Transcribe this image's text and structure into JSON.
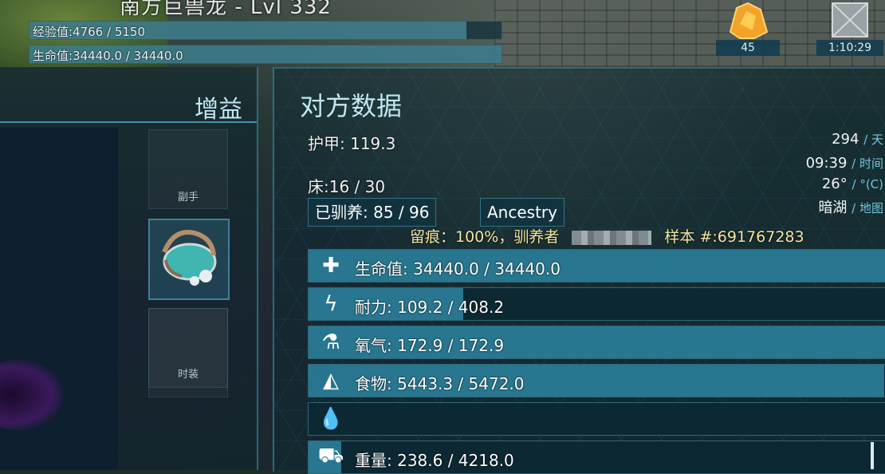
{
  "creature": {
    "name": "南方巨兽龙 - Lvl 332",
    "xp_text": "经验值:4766 / 5150",
    "xp_progress": 0.925,
    "health_text": "生命值:34440.0 / 34440.0",
    "health_progress": 1.0
  },
  "top_right": {
    "item_count": "45",
    "timer": "1:10:29"
  },
  "left_panel": {
    "title": "增益",
    "slots": [
      {
        "label": "副手",
        "filled": false
      },
      {
        "label": "",
        "filled": true,
        "icon": "saddle-icon"
      },
      {
        "label": "",
        "filled": false
      },
      {
        "label": "时装",
        "filled": false
      }
    ]
  },
  "right_panel": {
    "title": "对方数据",
    "armor": "护甲: 119.3",
    "beds": "床:16 / 30",
    "tamed": "已驯养: 85 / 96",
    "ancestry_button": "Ancestry",
    "imprint_prefix": "留痕：100%，驯养者",
    "imprint_suffix": "样本 #:691767283",
    "info": {
      "day": "294",
      "day_unit": "/ 天",
      "time": "09:39",
      "time_unit": "/ 时间",
      "temp": "26°",
      "temp_unit": "/ °(C)",
      "location": "暗湖",
      "location_unit": "/ 地图"
    },
    "stats": [
      {
        "icon": "health-cross-icon",
        "glyph": "✚",
        "text": "生命值: 34440.0 / 34440.0",
        "progress": 1.0
      },
      {
        "icon": "stamina-bolt-icon",
        "glyph": "ϟ",
        "text": "耐力: 109.2 / 408.2",
        "progress": 0.267
      },
      {
        "icon": "oxygen-tank-icon",
        "glyph": "⚗",
        "text": "氧气: 172.9 / 172.9",
        "progress": 1.0
      },
      {
        "icon": "food-drumstick-icon",
        "glyph": "◭",
        "text": "食物: 5443.3 / 5472.0",
        "progress": 0.995
      },
      {
        "icon": "water-drop-icon",
        "glyph": "💧",
        "text": "",
        "progress": 0.0
      },
      {
        "icon": "weight-icon",
        "glyph": "⛟",
        "text": "重量: 238.6 / 4218.0",
        "progress": 0.057
      }
    ]
  }
}
